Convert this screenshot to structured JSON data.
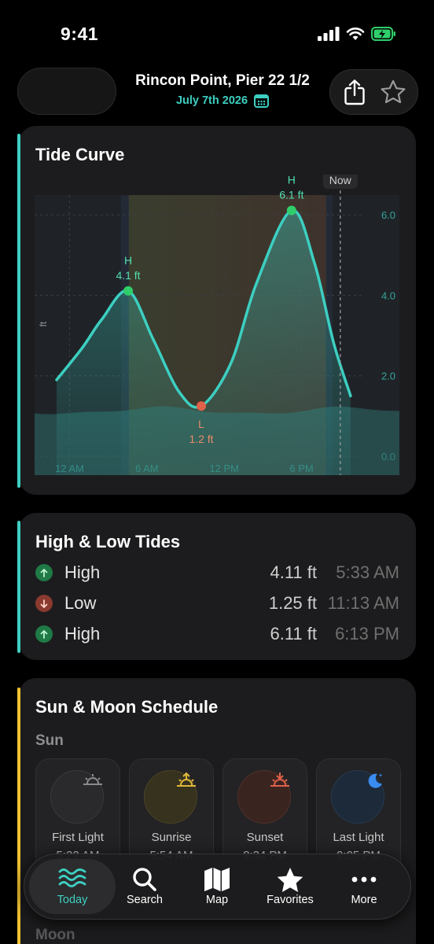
{
  "status_bar": {
    "time": "9:41"
  },
  "header": {
    "location": "Rincon Point, Pier 22 1/2",
    "date": "July 7th 2026"
  },
  "colors": {
    "accent": "#3ccfc1",
    "high": "#2fce6a",
    "low": "#e0614a",
    "sun_card_accent": "#f2c230"
  },
  "tide_card": {
    "title": "Tide Curve",
    "y_axis_unit": "ft",
    "now_label": "Now"
  },
  "chart_data": {
    "type": "area",
    "title": "Tide Curve",
    "xlabel": "",
    "ylabel": "ft",
    "x_ticks": [
      "12 AM",
      "6 AM",
      "12 PM",
      "6 PM"
    ],
    "y_ticks": [
      "0.0",
      "2.0",
      "4.0",
      "6.0"
    ],
    "ylim": [
      0,
      7
    ],
    "x_range_hours": [
      0,
      25
    ],
    "series": [
      {
        "x": [
          0,
          2,
          3.5,
          5.55,
          7.5,
          9.5,
          11.22,
          13.5,
          15.5,
          18.22,
          20,
          21.5,
          22.8
        ],
        "y": [
          1.9,
          2.7,
          3.4,
          4.11,
          2.9,
          1.6,
          1.25,
          2.3,
          4.3,
          6.11,
          4.8,
          2.8,
          1.5
        ]
      }
    ],
    "extrema": [
      {
        "kind": "H",
        "value": "4.1 ft",
        "x": 5.55,
        "y": 4.11
      },
      {
        "kind": "L",
        "value": "1.2 ft",
        "x": 11.22,
        "y": 1.25
      },
      {
        "kind": "H",
        "value": "6.1 ft",
        "x": 18.22,
        "y": 6.11
      }
    ],
    "now_hour": 22.0,
    "daylight_hours": [
      5.6,
      20.9
    ],
    "twilight_hours": [
      5.0,
      21.4
    ],
    "grid": true
  },
  "high_low_card": {
    "title": "High & Low Tides",
    "rows": [
      {
        "type": "High",
        "height": "4.11 ft",
        "time": "5:33 AM",
        "direction": "up"
      },
      {
        "type": "Low",
        "height": "1.25 ft",
        "time": "11:13 AM",
        "direction": "down"
      },
      {
        "type": "High",
        "height": "6.11 ft",
        "time": "6:13 PM",
        "direction": "up"
      }
    ]
  },
  "sun_moon_card": {
    "title": "Sun & Moon Schedule",
    "sun_label": "Sun",
    "moon_label": "Moon",
    "sun_tiles": [
      {
        "label": "First Light",
        "time": "5:22 AM",
        "icon": "first-light-icon"
      },
      {
        "label": "Sunrise",
        "time": "5:54 AM",
        "icon": "sunrise-icon"
      },
      {
        "label": "Sunset",
        "time": "8:34 PM",
        "icon": "sunset-icon"
      },
      {
        "label": "Last Light",
        "time": "9:05 PM",
        "icon": "moon-icon"
      }
    ]
  },
  "tabbar": {
    "tabs": [
      {
        "label": "Today",
        "icon": "waves-icon"
      },
      {
        "label": "Search",
        "icon": "search-icon"
      },
      {
        "label": "Map",
        "icon": "map-icon"
      },
      {
        "label": "Favorites",
        "icon": "star-icon"
      },
      {
        "label": "More",
        "icon": "more-icon"
      }
    ]
  }
}
